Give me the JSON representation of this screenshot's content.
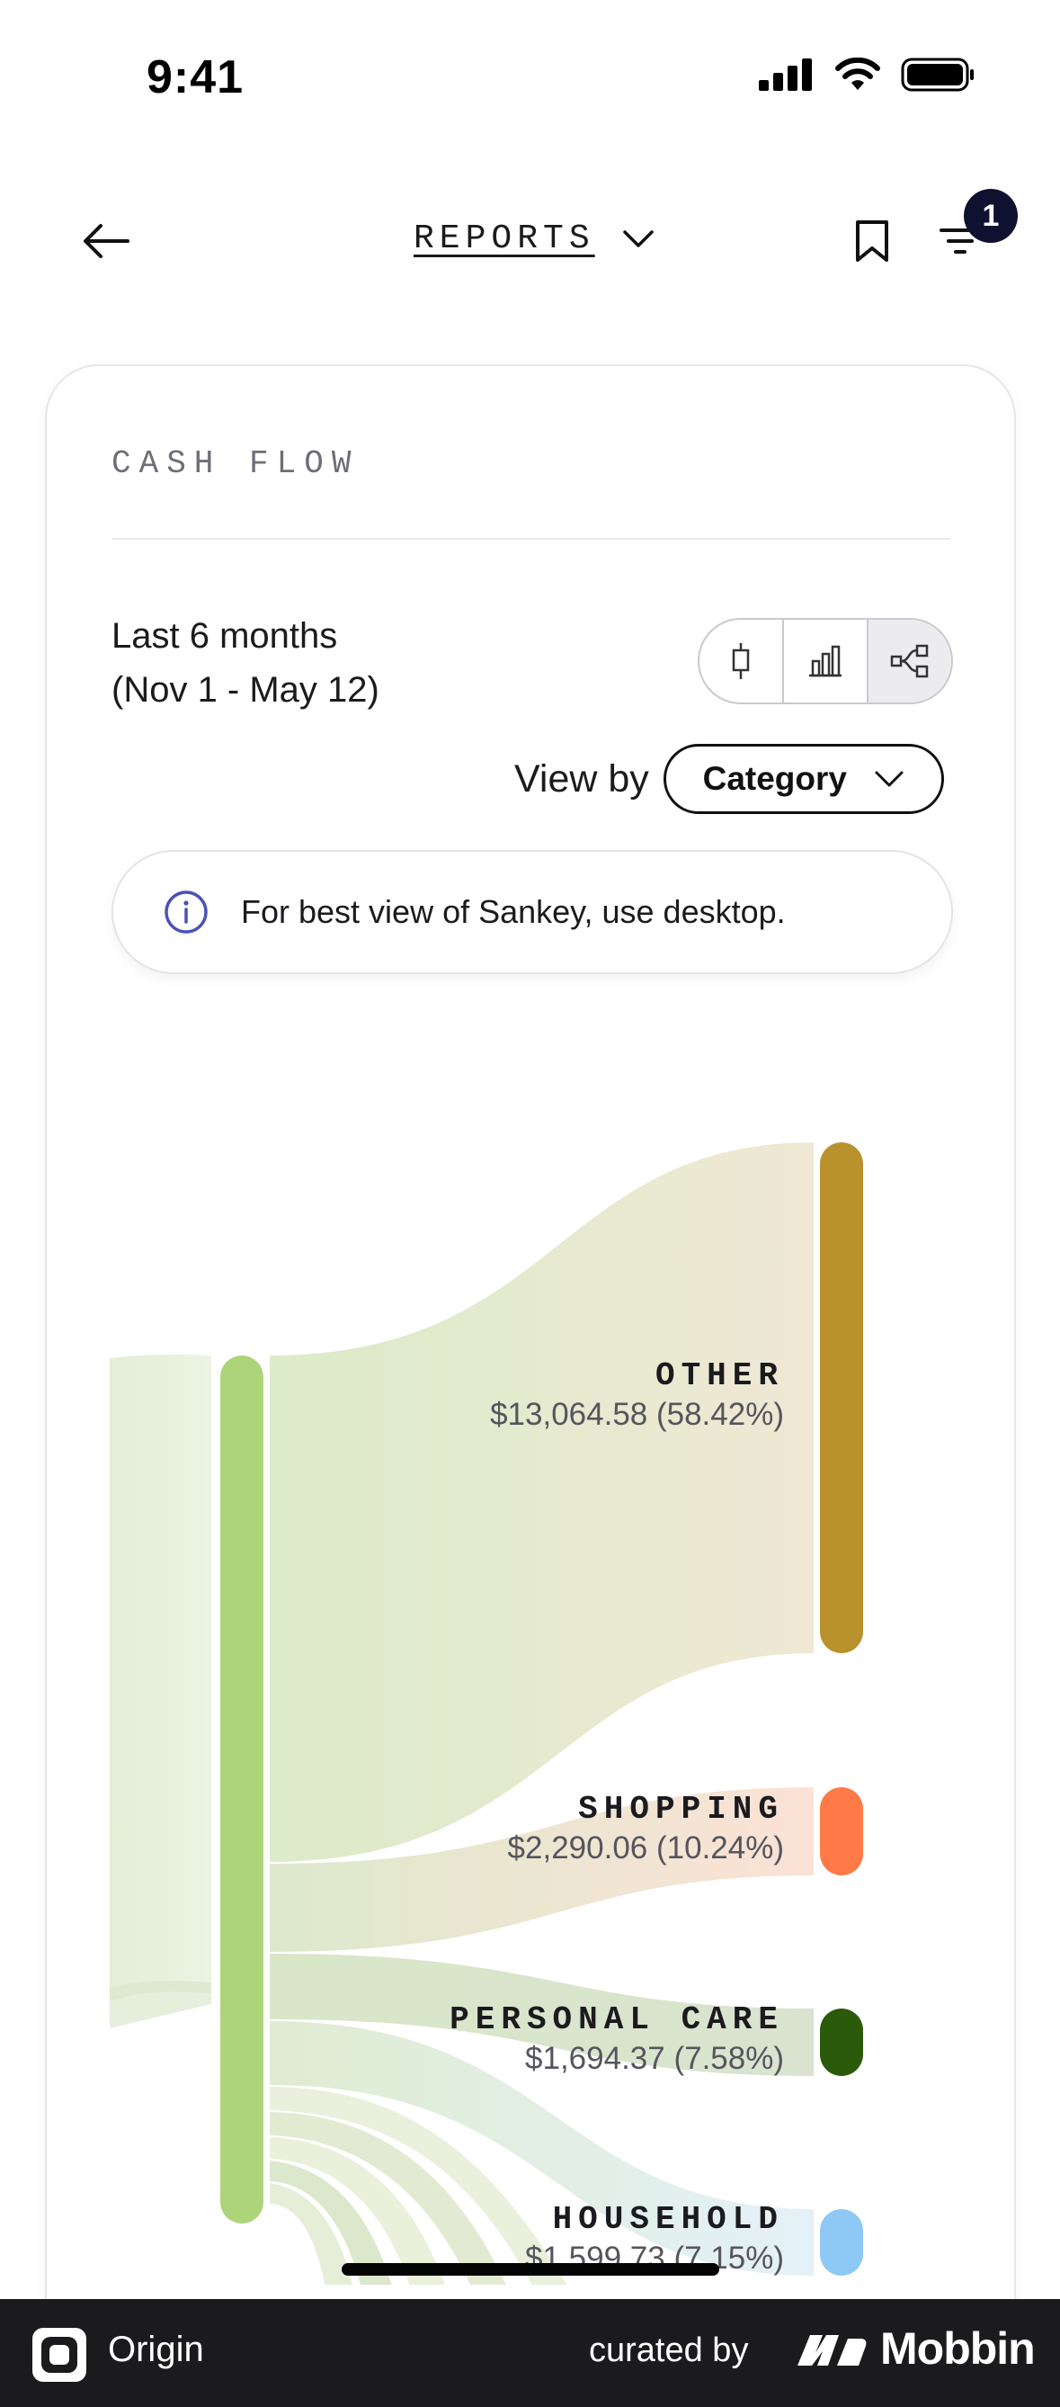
{
  "status": {
    "time": "9:41"
  },
  "nav": {
    "title": "REPORTS",
    "filter_count": "1"
  },
  "card": {
    "title": "CASH FLOW",
    "range_line1": "Last 6 months",
    "range_line2": "(Nov 1 - May 12)",
    "view_by_label": "View by",
    "view_by_value": "Category",
    "info_text": "For best view of Sankey, use desktop."
  },
  "chart_data": {
    "type": "sankey",
    "nodes": [
      {
        "name": "OTHER",
        "value": "$13,064.58 (58.42%)",
        "color": "#b9922e"
      },
      {
        "name": "SHOPPING",
        "value": "$2,290.06 (10.24%)",
        "color": "#ff7a47"
      },
      {
        "name": "PERSONAL CARE",
        "value": "$1,694.37 (7.58%)",
        "color": "#2a5a0a"
      },
      {
        "name": "HOUSEHOLD",
        "value": "$1,599.73 (7.15%)",
        "color": "#8ec9f5"
      }
    ],
    "source_color": "#aed47a"
  },
  "footer": {
    "app_name": "Origin",
    "curated_by": "curated by",
    "brand": "Mobbin"
  }
}
